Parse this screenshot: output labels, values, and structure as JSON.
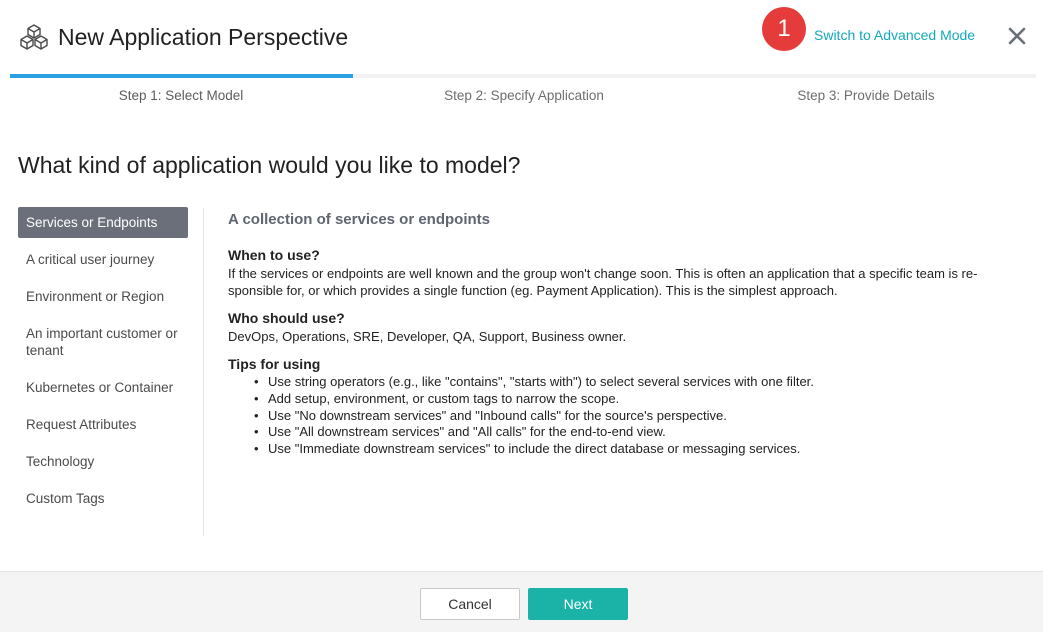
{
  "dialog": {
    "title": "New Application Perspective",
    "app_icon": "application-cubes-icon",
    "badge_number": "1",
    "advanced_mode_link": "Switch to Advanced Mode",
    "close_icon": "close-icon"
  },
  "steps": [
    {
      "label": "Step 1: Select Model",
      "active": true
    },
    {
      "label": "Step 2: Specify Application",
      "active": false
    },
    {
      "label": "Step 3: Provide Details",
      "active": false
    }
  ],
  "question": "What kind of application would you like to model?",
  "nav": {
    "items": [
      {
        "label": "Services or Endpoints",
        "selected": true
      },
      {
        "label": "A critical user journey"
      },
      {
        "label": "Environment or Region"
      },
      {
        "label": "An important customer or tenant"
      },
      {
        "label": "Kubernetes or Container"
      },
      {
        "label": "Request Attributes"
      },
      {
        "label": "Technology"
      },
      {
        "label": "Custom Tags"
      }
    ]
  },
  "detail": {
    "heading": "A collection of services or endpoints",
    "when_title": "When to use?",
    "when_text": "If the services or endpoints are well known and the group won't change soon. This is often an application that a specific team is re-sponsible for, or which provides a single function (eg. Payment Application). This is the simplest approach.",
    "who_title": "Who should use?",
    "who_text": "DevOps, Operations, SRE, Developer, QA, Support, Business owner.",
    "tips_title": "Tips for using",
    "tips": [
      "Use string operators (e.g., like \"contains\", \"starts with\") to select several services with one filter.",
      "Add setup, environment, or custom tags to narrow the scope.",
      "Use \"No downstream services\" and \"Inbound calls\" for the source's perspective.",
      "Use \"All downstream services\" and \"All calls\" for the end-to-end view.",
      "Use \"Immediate downstream services\" to include the direct database or messaging services."
    ]
  },
  "footer": {
    "cancel_label": "Cancel",
    "next_label": "Next"
  },
  "colors": {
    "accent_teal": "#1bb3a7",
    "link_teal": "#14a8b9",
    "progress_blue": "#2aa0e0",
    "badge_red": "#e63b3b",
    "nav_selected": "#6b6f7a"
  }
}
